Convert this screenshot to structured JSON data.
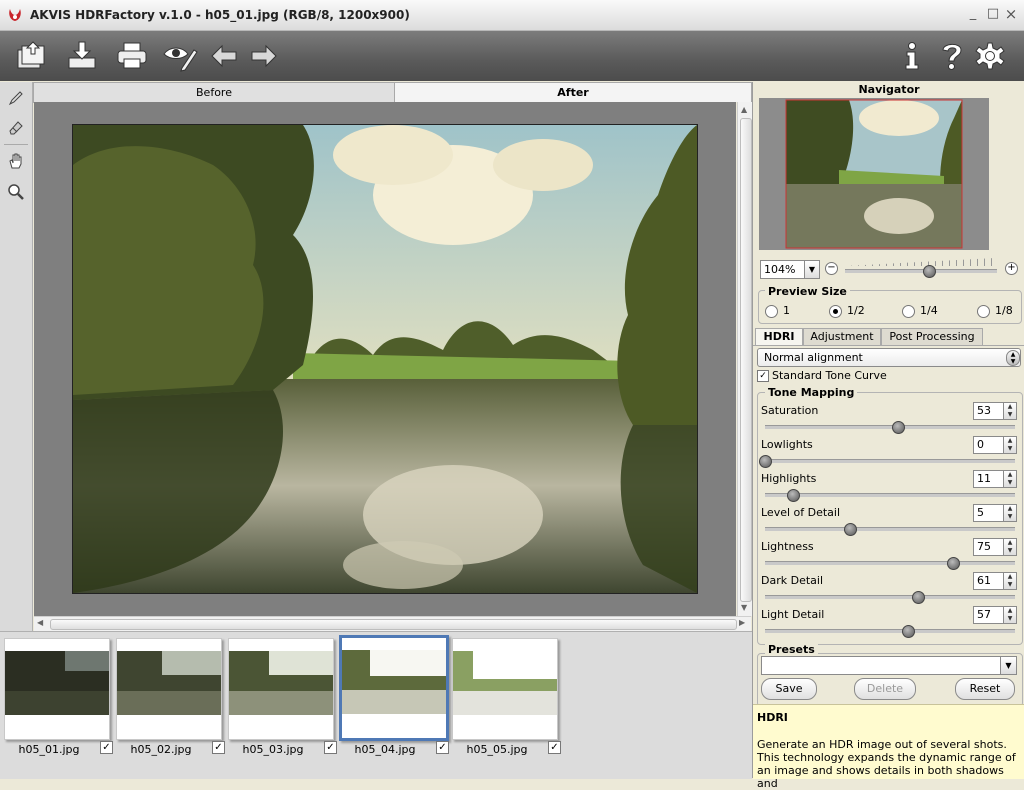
{
  "window": {
    "title": "AKVIS HDRFactory v.1.0 - h05_01.jpg (RGB/8, 1200x900)",
    "minimize": "_",
    "maximize": "□",
    "close": "×"
  },
  "toolbar": {
    "left_icons": [
      "open-icon",
      "save-icon",
      "print-icon",
      "batch-edit-icon",
      "undo-icon",
      "redo-icon"
    ],
    "right_icons": [
      "info-icon",
      "help-icon",
      "settings-icon"
    ]
  },
  "tools": [
    "brush-icon",
    "eraser-icon",
    "hand-icon",
    "zoom-icon"
  ],
  "view_tabs": {
    "before": "Before",
    "after": "After",
    "active": "After"
  },
  "filmstrip": {
    "items": [
      {
        "label": "h05_01.jpg",
        "checked": true,
        "selected": false,
        "exposure": 0.18
      },
      {
        "label": "h05_02.jpg",
        "checked": true,
        "selected": false,
        "exposure": 0.42
      },
      {
        "label": "h05_03.jpg",
        "checked": true,
        "selected": false,
        "exposure": 0.62
      },
      {
        "label": "h05_04.jpg",
        "checked": true,
        "selected": true,
        "exposure": 0.8
      },
      {
        "label": "h05_05.jpg",
        "checked": true,
        "selected": false,
        "exposure": 0.95
      }
    ]
  },
  "navigator": {
    "title": "Navigator",
    "zoom": "104%",
    "zoom_level": 0.55
  },
  "preview_size": {
    "title": "Preview Size",
    "options": [
      "1",
      "1/2",
      "1/4",
      "1/8"
    ],
    "selected": "1/2"
  },
  "tabs": {
    "hdri": "HDRI",
    "adjustment": "Adjustment",
    "post": "Post Processing",
    "active": "HDRI"
  },
  "alignment": {
    "value": "Normal alignment"
  },
  "tone_curve": {
    "label": "Standard Tone Curve",
    "checked": true
  },
  "tone_mapping": {
    "title": "Tone Mapping",
    "params": [
      {
        "label": "Saturation",
        "value": "53",
        "pos": 0.53
      },
      {
        "label": "Lowlights",
        "value": "0",
        "pos": 0.0
      },
      {
        "label": "Highlights",
        "value": "11",
        "pos": 0.11
      },
      {
        "label": "Level of Detail",
        "value": "5",
        "pos": 0.34
      },
      {
        "label": "Lightness",
        "value": "75",
        "pos": 0.75
      },
      {
        "label": "Dark Detail",
        "value": "61",
        "pos": 0.61
      },
      {
        "label": "Light Detail",
        "value": "57",
        "pos": 0.57
      }
    ]
  },
  "presets": {
    "title": "Presets",
    "value": "",
    "save": "Save",
    "delete": "Delete",
    "reset": "Reset"
  },
  "help": {
    "title": "HDRI",
    "text": "Generate an HDR image out of several shots. This technology expands the dynamic range of an image and shows details in both shadows and"
  }
}
